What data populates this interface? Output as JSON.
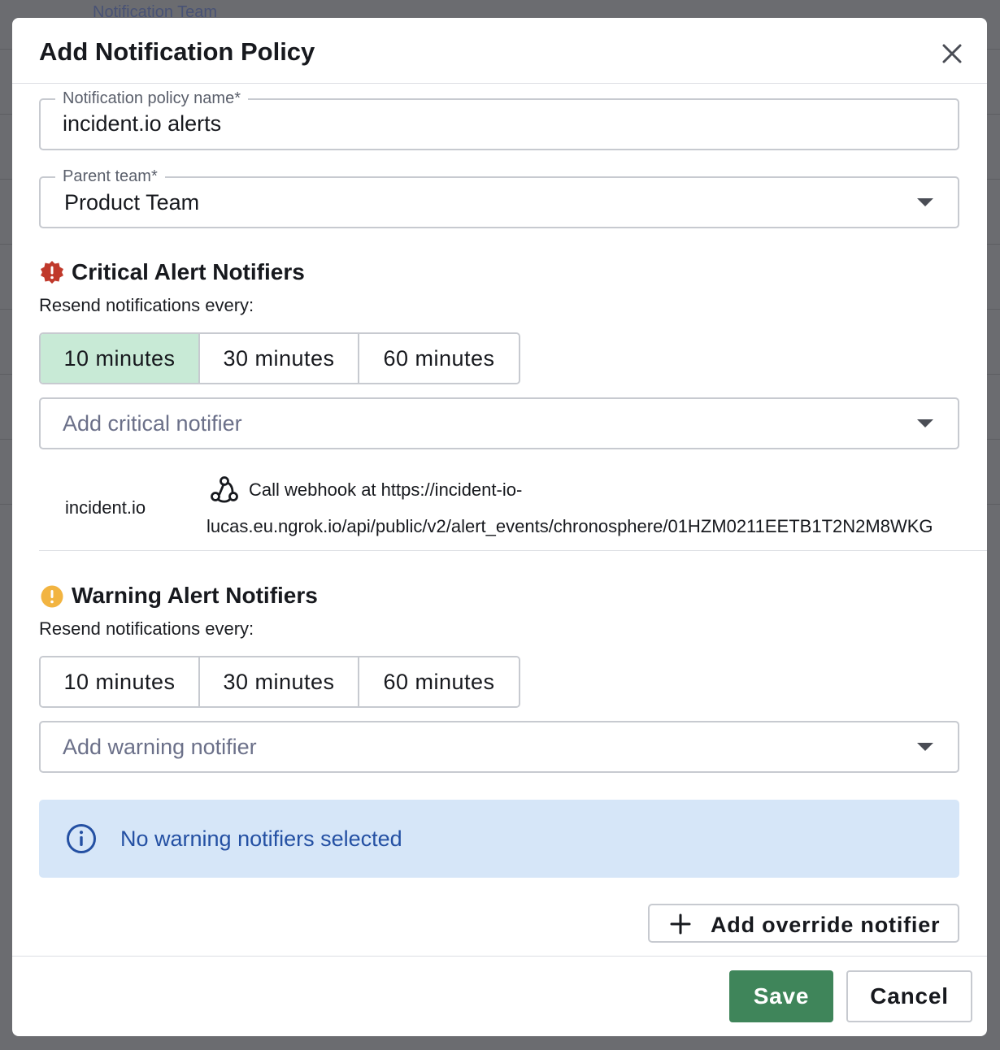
{
  "background": {
    "peek_text": "Notification Team"
  },
  "modal": {
    "title": "Add Notification Policy",
    "close_icon": "close-icon"
  },
  "fields": {
    "policy_name": {
      "legend": "Notification policy name*",
      "value": "incident.io alerts"
    },
    "parent_team": {
      "legend": "Parent team*",
      "value": "Product Team"
    }
  },
  "critical": {
    "icon": "critical-alert-icon",
    "icon_color": "#c0392b",
    "title": "Critical Alert Notifiers",
    "resend_label": "Resend notifications every:",
    "intervals": [
      "10 minutes",
      "30 minutes",
      "60 minutes"
    ],
    "selected_interval": "10 minutes",
    "add_placeholder": "Add critical notifier",
    "notifiers": [
      {
        "name": "incident.io",
        "icon": "webhook-icon",
        "action_line1": "Call webhook at https://incident-io-",
        "action_line2": "lucas.eu.ngrok.io/api/public/v2/alert_events/chronosphere/01HZM0211EETB1T2N2M8WKG"
      }
    ]
  },
  "warning": {
    "icon": "warning-alert-icon",
    "icon_color": "#f2b441",
    "title": "Warning Alert Notifiers",
    "resend_label": "Resend notifications every:",
    "intervals": [
      "10 minutes",
      "30 minutes",
      "60 minutes"
    ],
    "selected_interval": null,
    "add_placeholder": "Add warning notifier",
    "empty_message": "No warning notifiers selected"
  },
  "actions": {
    "add_override": "Add override notifier",
    "save": "Save",
    "cancel": "Cancel"
  },
  "colors": {
    "active_segment": "#c8ead6",
    "save_button": "#3f855a",
    "info_background": "#d6e6f8",
    "info_text": "#2450a3"
  }
}
